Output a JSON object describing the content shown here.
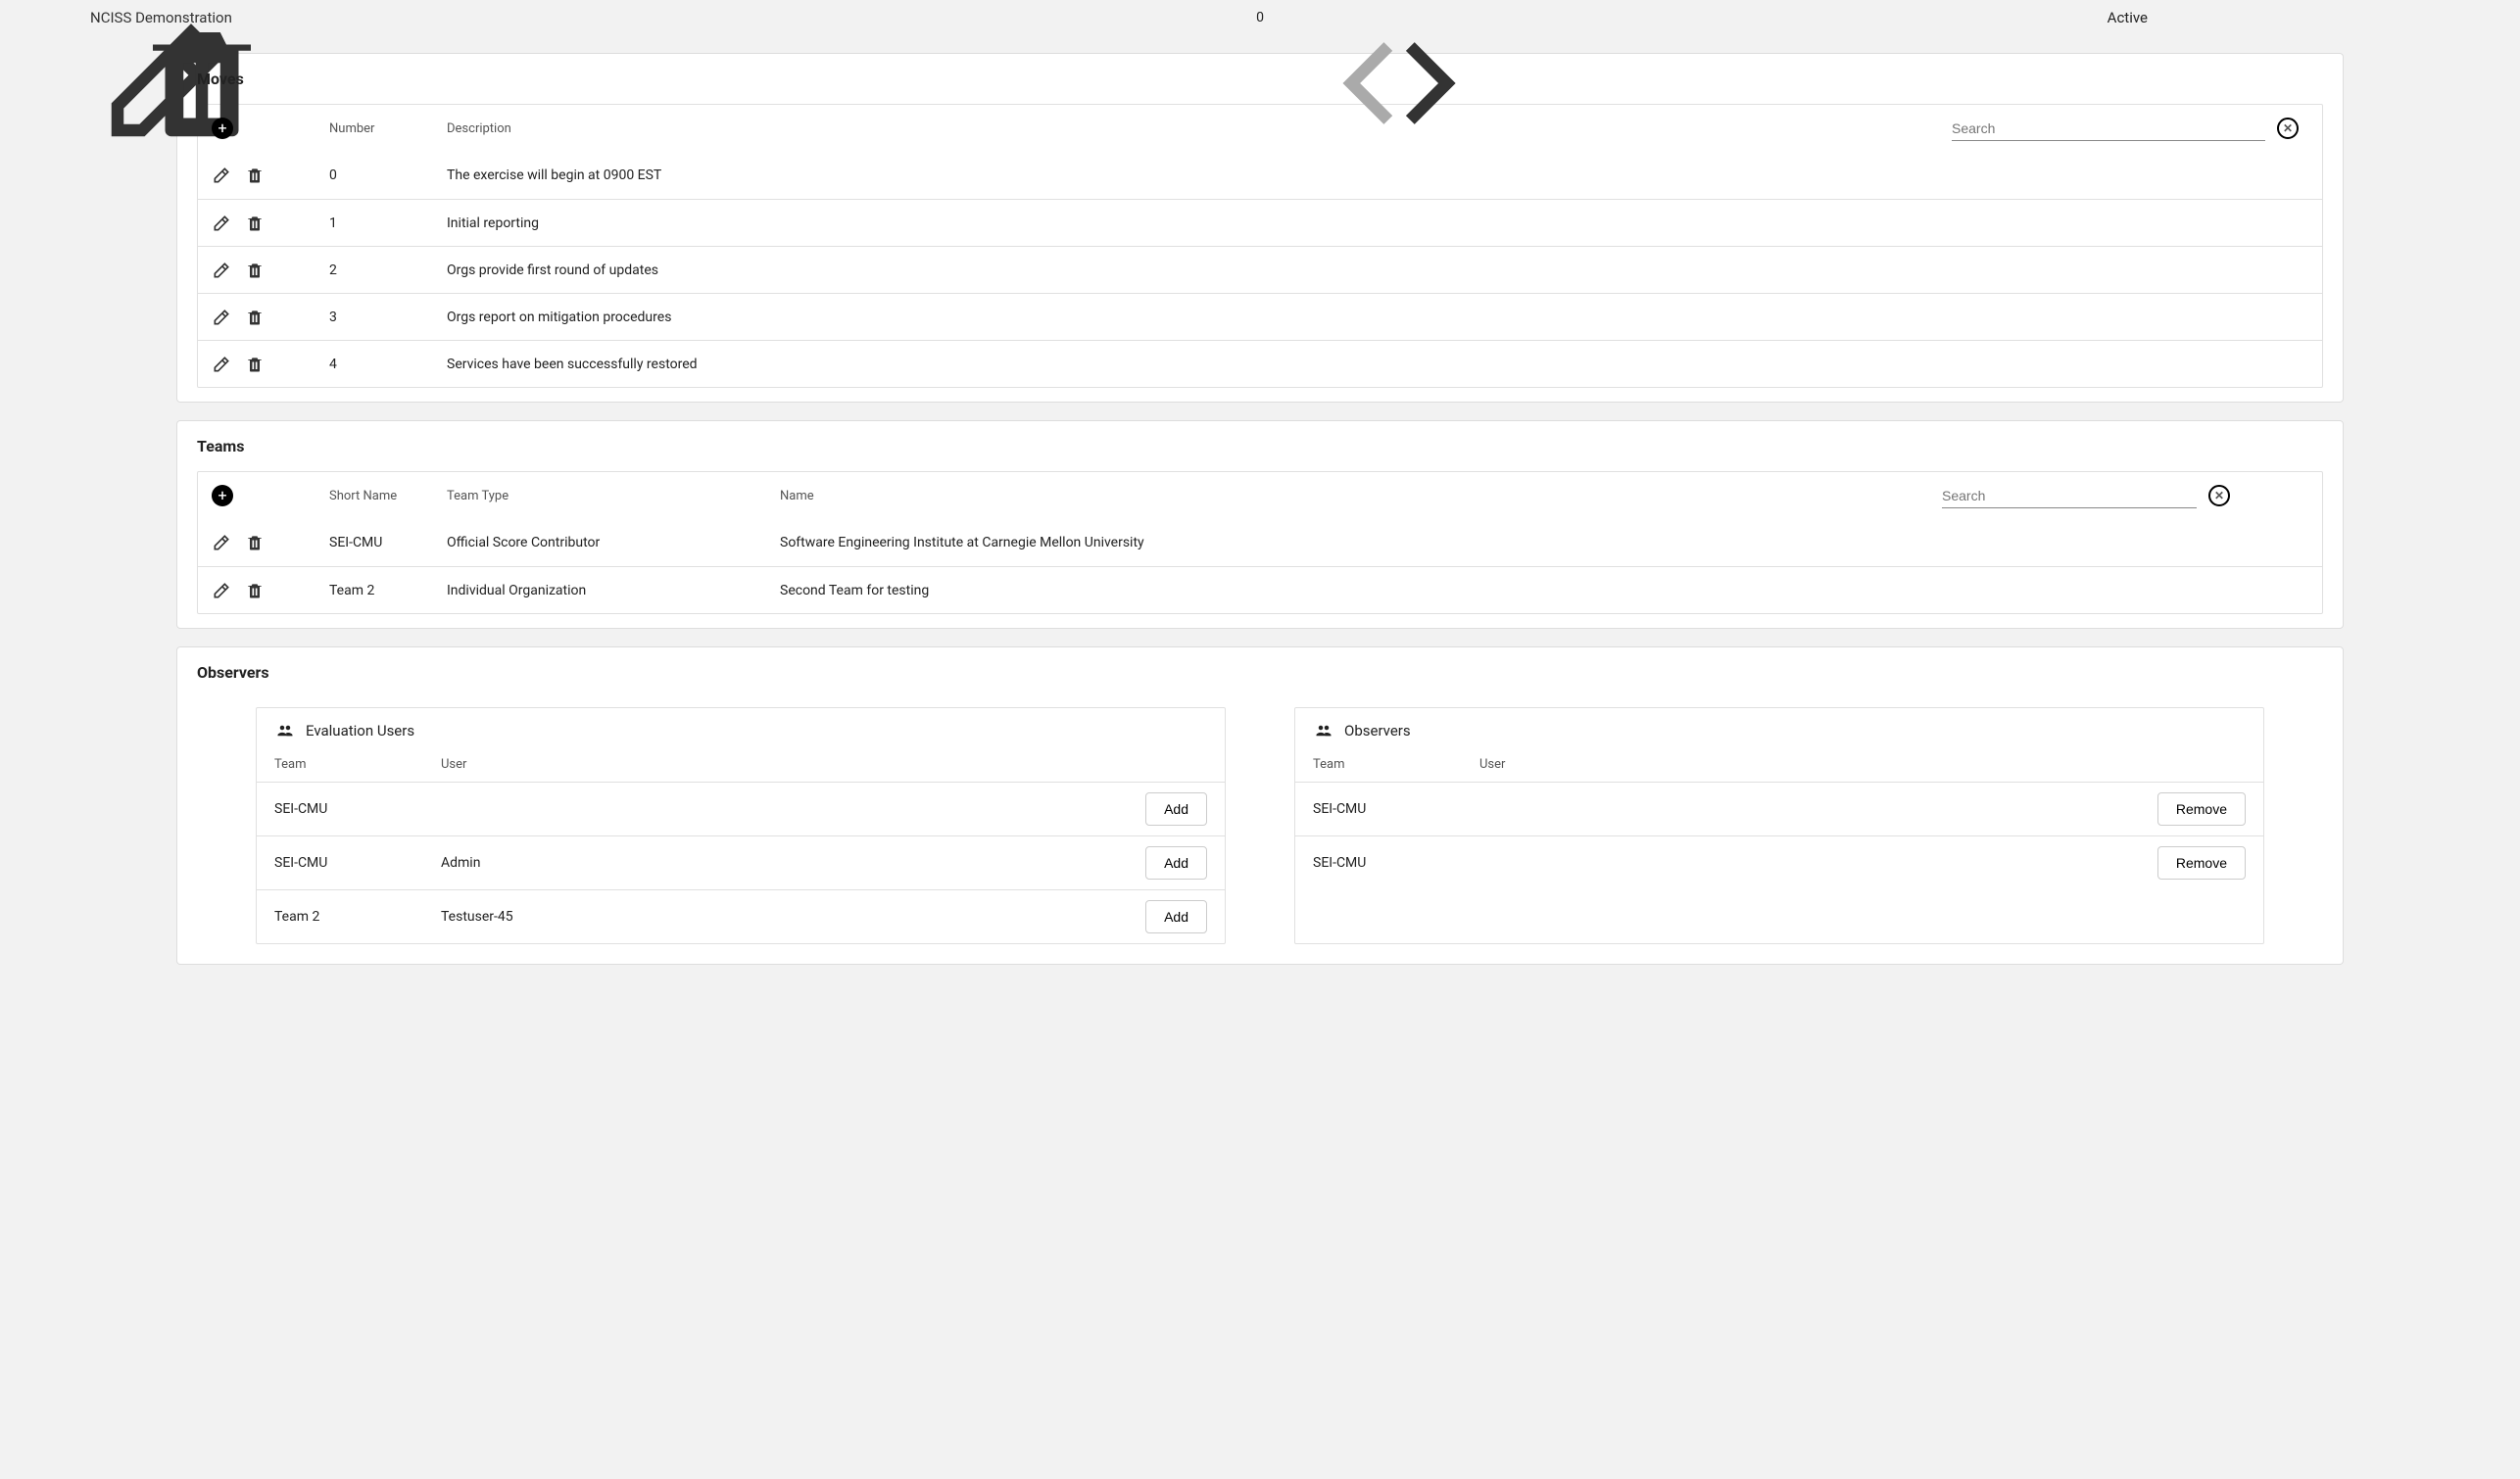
{
  "top": {
    "title": "NCISS Demonstration",
    "pager_value": "0",
    "status": "Active"
  },
  "moves": {
    "section_title": "Moves",
    "headers": {
      "number": "Number",
      "description": "Description"
    },
    "search_placeholder": "Search",
    "rows": [
      {
        "number": "0",
        "description": "The exercise will begin at 0900 EST"
      },
      {
        "number": "1",
        "description": "Initial reporting"
      },
      {
        "number": "2",
        "description": "Orgs provide first round of updates"
      },
      {
        "number": "3",
        "description": "Orgs report on mitigation procedures"
      },
      {
        "number": "4",
        "description": "Services have been successfully restored"
      }
    ]
  },
  "teams": {
    "section_title": "Teams",
    "headers": {
      "short_name": "Short Name",
      "team_type": "Team Type",
      "name": "Name"
    },
    "search_placeholder": "Search",
    "rows": [
      {
        "short_name": "SEI-CMU",
        "team_type": "Official Score Contributor",
        "name": "Software Engineering Institute at Carnegie Mellon University"
      },
      {
        "short_name": "Team 2",
        "team_type": "Individual Organization",
        "name": "Second Team for testing"
      }
    ]
  },
  "observers": {
    "section_title": "Observers",
    "eval_users": {
      "title": "Evaluation Users",
      "headers": {
        "team": "Team",
        "user": "User"
      },
      "button_label": "Add",
      "rows": [
        {
          "team": "SEI-CMU",
          "user": ""
        },
        {
          "team": "SEI-CMU",
          "user": "Admin"
        },
        {
          "team": "Team 2",
          "user": "Testuser-45"
        }
      ]
    },
    "observer_list": {
      "title": "Observers",
      "headers": {
        "team": "Team",
        "user": "User"
      },
      "button_label": "Remove",
      "rows": [
        {
          "team": "SEI-CMU",
          "user": ""
        },
        {
          "team": "SEI-CMU",
          "user": ""
        }
      ]
    }
  }
}
